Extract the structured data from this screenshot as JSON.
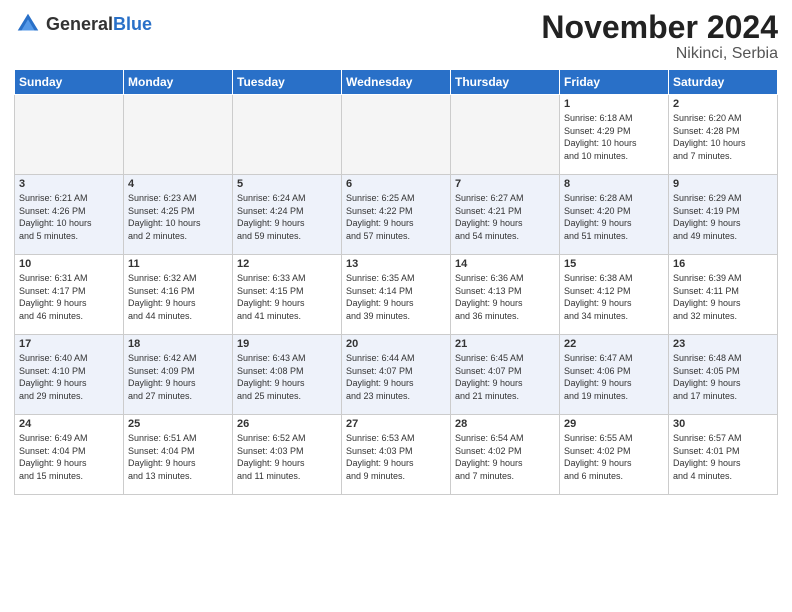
{
  "logo": {
    "text_general": "General",
    "text_blue": "Blue"
  },
  "header": {
    "month": "November 2024",
    "location": "Nikinci, Serbia"
  },
  "weekdays": [
    "Sunday",
    "Monday",
    "Tuesday",
    "Wednesday",
    "Thursday",
    "Friday",
    "Saturday"
  ],
  "weeks": [
    [
      {
        "day": "",
        "info": ""
      },
      {
        "day": "",
        "info": ""
      },
      {
        "day": "",
        "info": ""
      },
      {
        "day": "",
        "info": ""
      },
      {
        "day": "",
        "info": ""
      },
      {
        "day": "1",
        "info": "Sunrise: 6:18 AM\nSunset: 4:29 PM\nDaylight: 10 hours\nand 10 minutes."
      },
      {
        "day": "2",
        "info": "Sunrise: 6:20 AM\nSunset: 4:28 PM\nDaylight: 10 hours\nand 7 minutes."
      }
    ],
    [
      {
        "day": "3",
        "info": "Sunrise: 6:21 AM\nSunset: 4:26 PM\nDaylight: 10 hours\nand 5 minutes."
      },
      {
        "day": "4",
        "info": "Sunrise: 6:23 AM\nSunset: 4:25 PM\nDaylight: 10 hours\nand 2 minutes."
      },
      {
        "day": "5",
        "info": "Sunrise: 6:24 AM\nSunset: 4:24 PM\nDaylight: 9 hours\nand 59 minutes."
      },
      {
        "day": "6",
        "info": "Sunrise: 6:25 AM\nSunset: 4:22 PM\nDaylight: 9 hours\nand 57 minutes."
      },
      {
        "day": "7",
        "info": "Sunrise: 6:27 AM\nSunset: 4:21 PM\nDaylight: 9 hours\nand 54 minutes."
      },
      {
        "day": "8",
        "info": "Sunrise: 6:28 AM\nSunset: 4:20 PM\nDaylight: 9 hours\nand 51 minutes."
      },
      {
        "day": "9",
        "info": "Sunrise: 6:29 AM\nSunset: 4:19 PM\nDaylight: 9 hours\nand 49 minutes."
      }
    ],
    [
      {
        "day": "10",
        "info": "Sunrise: 6:31 AM\nSunset: 4:17 PM\nDaylight: 9 hours\nand 46 minutes."
      },
      {
        "day": "11",
        "info": "Sunrise: 6:32 AM\nSunset: 4:16 PM\nDaylight: 9 hours\nand 44 minutes."
      },
      {
        "day": "12",
        "info": "Sunrise: 6:33 AM\nSunset: 4:15 PM\nDaylight: 9 hours\nand 41 minutes."
      },
      {
        "day": "13",
        "info": "Sunrise: 6:35 AM\nSunset: 4:14 PM\nDaylight: 9 hours\nand 39 minutes."
      },
      {
        "day": "14",
        "info": "Sunrise: 6:36 AM\nSunset: 4:13 PM\nDaylight: 9 hours\nand 36 minutes."
      },
      {
        "day": "15",
        "info": "Sunrise: 6:38 AM\nSunset: 4:12 PM\nDaylight: 9 hours\nand 34 minutes."
      },
      {
        "day": "16",
        "info": "Sunrise: 6:39 AM\nSunset: 4:11 PM\nDaylight: 9 hours\nand 32 minutes."
      }
    ],
    [
      {
        "day": "17",
        "info": "Sunrise: 6:40 AM\nSunset: 4:10 PM\nDaylight: 9 hours\nand 29 minutes."
      },
      {
        "day": "18",
        "info": "Sunrise: 6:42 AM\nSunset: 4:09 PM\nDaylight: 9 hours\nand 27 minutes."
      },
      {
        "day": "19",
        "info": "Sunrise: 6:43 AM\nSunset: 4:08 PM\nDaylight: 9 hours\nand 25 minutes."
      },
      {
        "day": "20",
        "info": "Sunrise: 6:44 AM\nSunset: 4:07 PM\nDaylight: 9 hours\nand 23 minutes."
      },
      {
        "day": "21",
        "info": "Sunrise: 6:45 AM\nSunset: 4:07 PM\nDaylight: 9 hours\nand 21 minutes."
      },
      {
        "day": "22",
        "info": "Sunrise: 6:47 AM\nSunset: 4:06 PM\nDaylight: 9 hours\nand 19 minutes."
      },
      {
        "day": "23",
        "info": "Sunrise: 6:48 AM\nSunset: 4:05 PM\nDaylight: 9 hours\nand 17 minutes."
      }
    ],
    [
      {
        "day": "24",
        "info": "Sunrise: 6:49 AM\nSunset: 4:04 PM\nDaylight: 9 hours\nand 15 minutes."
      },
      {
        "day": "25",
        "info": "Sunrise: 6:51 AM\nSunset: 4:04 PM\nDaylight: 9 hours\nand 13 minutes."
      },
      {
        "day": "26",
        "info": "Sunrise: 6:52 AM\nSunset: 4:03 PM\nDaylight: 9 hours\nand 11 minutes."
      },
      {
        "day": "27",
        "info": "Sunrise: 6:53 AM\nSunset: 4:03 PM\nDaylight: 9 hours\nand 9 minutes."
      },
      {
        "day": "28",
        "info": "Sunrise: 6:54 AM\nSunset: 4:02 PM\nDaylight: 9 hours\nand 7 minutes."
      },
      {
        "day": "29",
        "info": "Sunrise: 6:55 AM\nSunset: 4:02 PM\nDaylight: 9 hours\nand 6 minutes."
      },
      {
        "day": "30",
        "info": "Sunrise: 6:57 AM\nSunset: 4:01 PM\nDaylight: 9 hours\nand 4 minutes."
      }
    ]
  ]
}
